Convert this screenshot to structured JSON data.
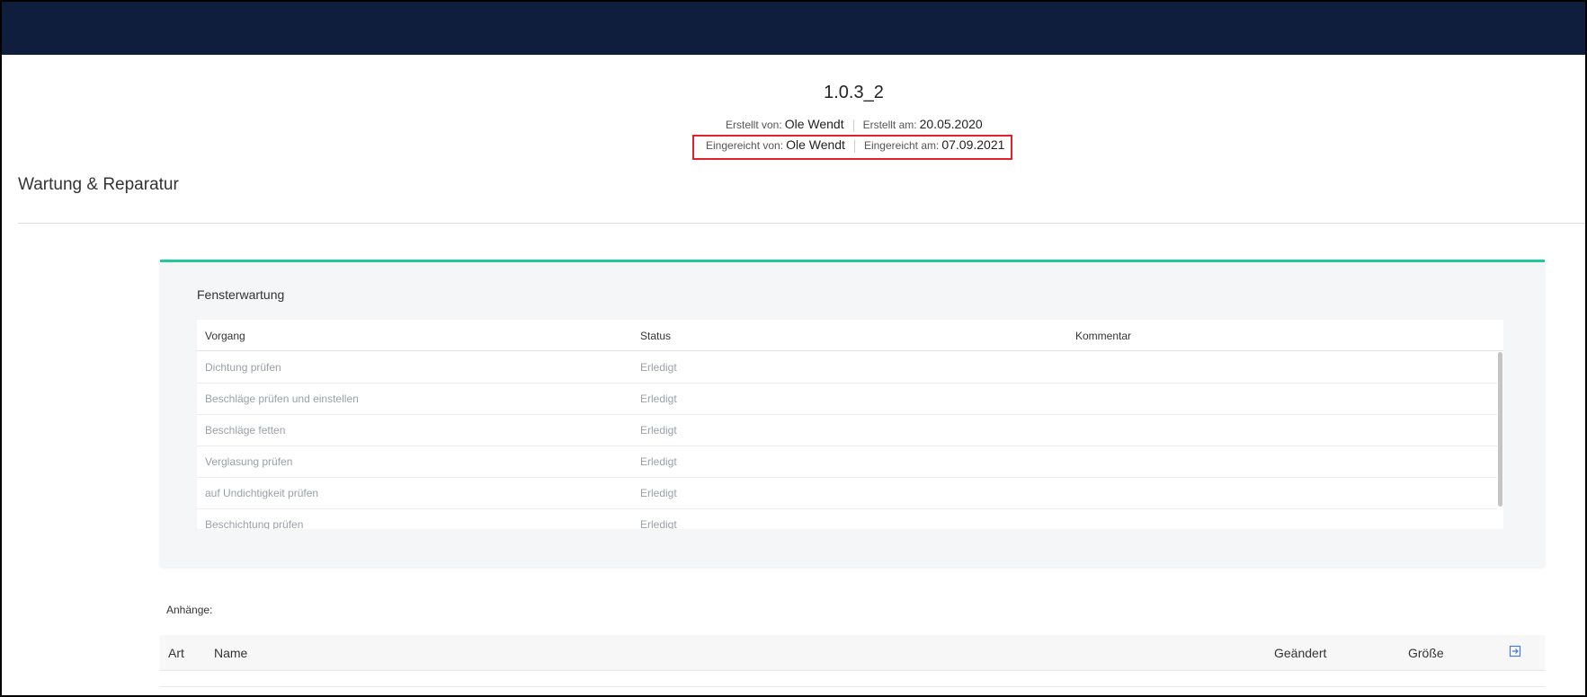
{
  "record": {
    "title": "1.0.3_2",
    "created_by_label": "Erstellt von:",
    "created_by": "Ole Wendt",
    "created_at_label": "Erstellt am:",
    "created_at": "20.05.2020",
    "submitted_by_label": "Eingereicht von:",
    "submitted_by": "Ole Wendt",
    "submitted_at_label": "Eingereicht am:",
    "submitted_at": "07.09.2021"
  },
  "section": {
    "title": "Wartung & Reparatur"
  },
  "card": {
    "title": "Fensterwartung",
    "accent_color": "#1fc99a",
    "columns": [
      "Vorgang",
      "Status",
      "Kommentar"
    ],
    "rows": [
      {
        "vorgang": "Dichtung prüfen",
        "status": "Erledigt",
        "kommentar": ""
      },
      {
        "vorgang": "Beschläge prüfen und einstellen",
        "status": "Erledigt",
        "kommentar": ""
      },
      {
        "vorgang": "Beschläge fetten",
        "status": "Erledigt",
        "kommentar": ""
      },
      {
        "vorgang": "Verglasung prüfen",
        "status": "Erledigt",
        "kommentar": ""
      },
      {
        "vorgang": "auf Undichtigkeit prüfen",
        "status": "Erledigt",
        "kommentar": ""
      },
      {
        "vorgang": "Beschichtung prüfen",
        "status": "Erledigt",
        "kommentar": ""
      }
    ]
  },
  "attachments": {
    "label": "Anhänge:",
    "columns": {
      "art": "Art",
      "name": "Name",
      "changed": "Geändert",
      "size": "Größe"
    },
    "export_icon": "export-icon"
  },
  "colors": {
    "topbar": "#0e1e3c",
    "highlight": "#e0202a"
  }
}
